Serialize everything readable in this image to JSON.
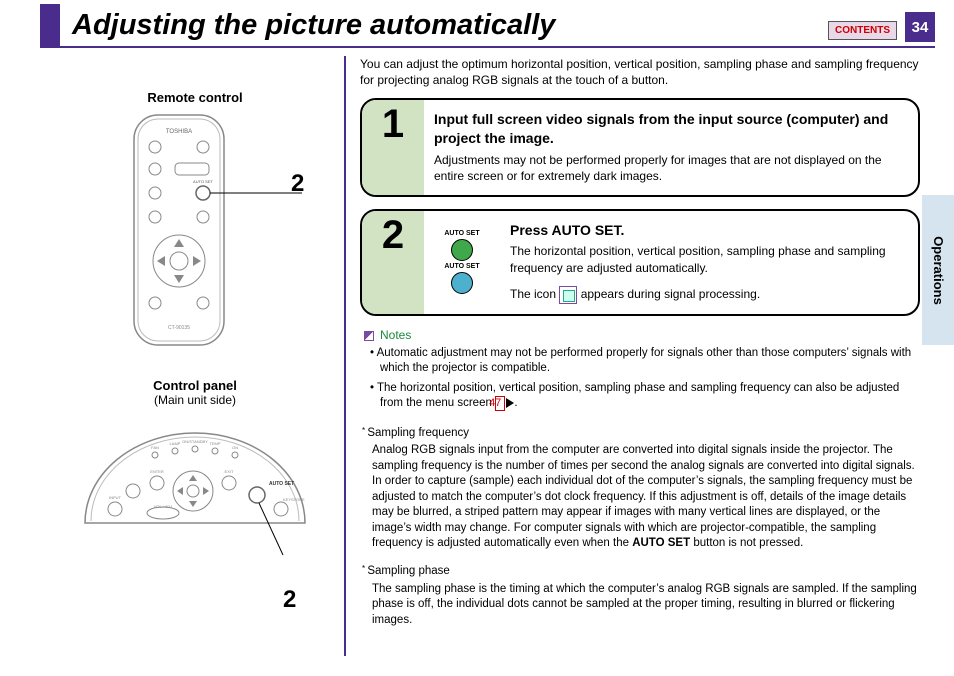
{
  "header": {
    "title": "Adjusting the picture automatically",
    "contents_btn": "CONTENTS",
    "page_number": "34"
  },
  "side_tab": "Operations",
  "left": {
    "remote_label": "Remote control",
    "callout_remote": "2",
    "control_panel_label": "Control panel",
    "control_panel_sub": "(Main unit side)",
    "callout_panel": "2",
    "remote_brand": "TOSHIBA"
  },
  "intro": "You can adjust the optimum horizontal position, vertical position, sampling phase and sampling frequency for projecting analog RGB signals at the touch of a button.",
  "steps": [
    {
      "num": "1",
      "title": "Input full screen video signals from the input source (computer) and project the image.",
      "body": "Adjustments may not be performed properly for images that are not displayed on the entire screen or for extremely dark images."
    },
    {
      "num": "2",
      "autoset_label": "AUTO SET",
      "title": "Press AUTO SET.",
      "body1": "The horizontal position, vertical position, sampling phase and sampling frequency are adjusted automatically.",
      "body2_a": "The icon ",
      "body2_b": " appears during signal processing."
    }
  ],
  "notes": {
    "header": "Notes",
    "items": [
      "Automatic adjustment may not be performed properly for signals other than those computers’ signals with which the projector is compatible.",
      "The horizontal position, vertical position, sampling phase and sampling frequency can also be adjusted from the menu screen "
    ],
    "ref": "47"
  },
  "glossary": [
    {
      "term": "Sampling frequency",
      "body_a": "Analog RGB signals input from the computer are converted into digital signals inside the projector. The sampling frequency is the number of times per second the analog signals are converted into digital signals. In order to capture (sample) each individual dot of the computer’s signals, the sampling frequency must be adjusted to match the computer’s dot clock frequency. If this adjustment is off, details of the image details may be blurred, a striped pattern may appear if images with many vertical lines are displayed, or the image’s width may change. For computer signals with which are projector-compatible, the sampling frequency is adjusted automatically even when the ",
      "body_bold": "AUTO SET",
      "body_b": " button is not pressed."
    },
    {
      "term": "Sampling phase",
      "body_a": "The sampling phase is the timing at which the computer’s analog RGB signals are sampled. If the sampling phase is off, the individual dots cannot be sampled at the proper timing, resulting in blurred or flickering images.",
      "body_bold": "",
      "body_b": ""
    }
  ]
}
